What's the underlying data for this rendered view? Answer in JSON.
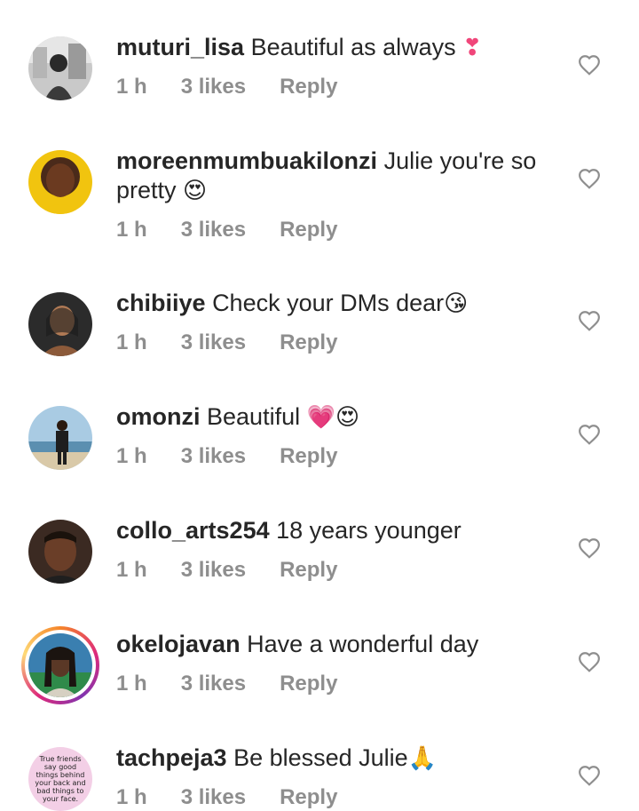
{
  "comments": [
    {
      "username": "muturi_lisa",
      "text": "Beautiful as always",
      "emoji": "❣",
      "time": "1 h",
      "likes": "3 likes",
      "reply": "Reply"
    },
    {
      "username": "moreenmumbuakilonzi",
      "text": "Julie you're so",
      "text2": "pretty",
      "emoji": "😍",
      "time": "1 h",
      "likes": "3 likes",
      "reply": "Reply"
    },
    {
      "username": "chibiiye",
      "text": "Check your DMs dear",
      "emoji": "😘",
      "time": "1 h",
      "likes": "3 likes",
      "reply": "Reply"
    },
    {
      "username": "omonzi",
      "text": "Beautiful",
      "emoji": "💗",
      "emoji2": "😍",
      "time": "1 h",
      "likes": "3 likes",
      "reply": "Reply"
    },
    {
      "username": "collo_arts254",
      "text": "18 years younger",
      "time": "1 h",
      "likes": "3 likes",
      "reply": "Reply"
    },
    {
      "username": "okelojavan",
      "text": "Have a wonderful day",
      "time": "1 h",
      "likes": "3 likes",
      "reply": "Reply"
    },
    {
      "username": "tachpeja3",
      "text": "Be blessed Julie",
      "emoji": "🙏",
      "time": "1 h",
      "likes": "3 likes",
      "reply": "Reply",
      "avatar_text": "True friends say good things behind your back and bad things to your face."
    }
  ],
  "colors": {
    "text": "#262626",
    "meta": "#8e8e8e",
    "heart_outline": "#8e8e8e"
  }
}
